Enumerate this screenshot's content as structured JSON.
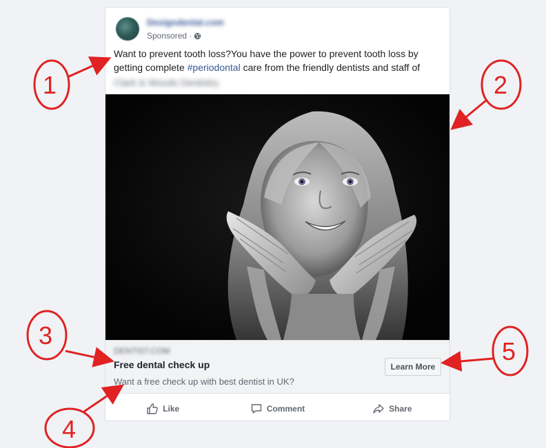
{
  "post": {
    "page_name": "Designdental.com",
    "sponsored": "Sponsored ·",
    "text_main": "Want to prevent tooth loss?You have the power to prevent tooth loss by getting complete ",
    "hashtag": "#periodontal",
    "text_after": " care from the friendly dentists and staff of",
    "text_blurred": "Clark & Woods Dentistry",
    "image_alt": "Smiling girl resting her chin on her hands"
  },
  "link": {
    "domain": "DENTIST.COM",
    "headline": "Free dental check up",
    "description": "Want a free check up with best dentist in UK?",
    "cta": "Learn More"
  },
  "actions": {
    "like": "Like",
    "comment": "Comment",
    "share": "Share"
  },
  "annotations": [
    "1",
    "2",
    "3",
    "4",
    "5"
  ],
  "colors": {
    "annotation": "#e02222",
    "link": "#385898"
  },
  "icons": [
    "globe-icon",
    "like-icon",
    "comment-icon",
    "share-icon"
  ]
}
